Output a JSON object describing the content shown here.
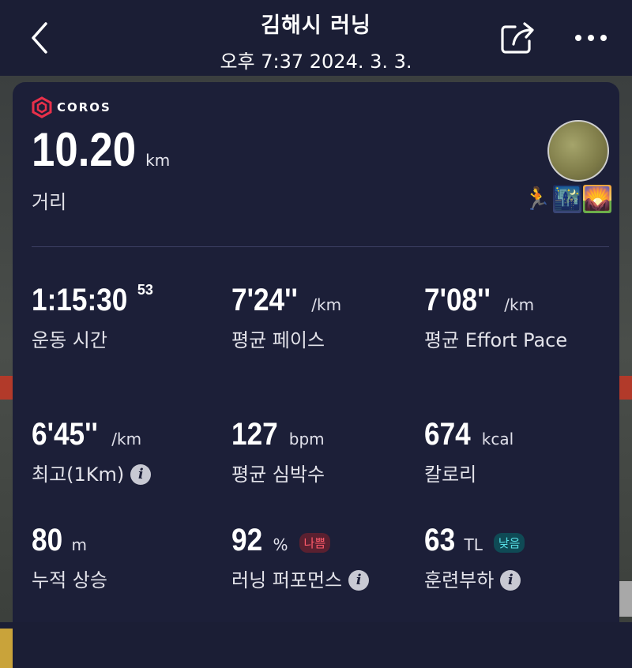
{
  "header": {
    "title": "김해시 러닝",
    "subtitle": "오후 7:37 2024. 3. 3."
  },
  "brand": {
    "name": "COROS",
    "color": "#e8304a"
  },
  "distance": {
    "value": "10.20",
    "unit": "km",
    "label": "거리"
  },
  "activity_icons": [
    "runner-emoji",
    "night-city-emoji",
    "sunrise-emoji"
  ],
  "stats": [
    {
      "value": "1:15:30",
      "sup": "53",
      "unit": "",
      "label": "운동 시간"
    },
    {
      "value": "7'24''",
      "unit": "/km",
      "label": "평균 페이스"
    },
    {
      "value": "7'08''",
      "unit": "/km",
      "label": "평균 Effort Pace"
    },
    {
      "value": "6'45''",
      "unit": "/km",
      "label": "최고(1Km)"
    },
    {
      "value": "127",
      "unit": "bpm",
      "label": "평균 심박수"
    },
    {
      "value": "674",
      "unit": "kcal",
      "label": "칼로리"
    },
    {
      "value": "80",
      "unit": "m",
      "label": "누적 상승"
    },
    {
      "value": "92",
      "unit": "%",
      "label": "러닝 퍼포먼스",
      "badge": "나쁨"
    },
    {
      "value": "63",
      "unit": "TL",
      "label": "훈련부하",
      "badge": "낮음"
    }
  ],
  "info_icon_glyph": "i",
  "colors": {
    "background": "#1b1e35",
    "card": "#1c1f38",
    "badge_bad": "#ff5a6a",
    "badge_low": "#58e0e6"
  }
}
